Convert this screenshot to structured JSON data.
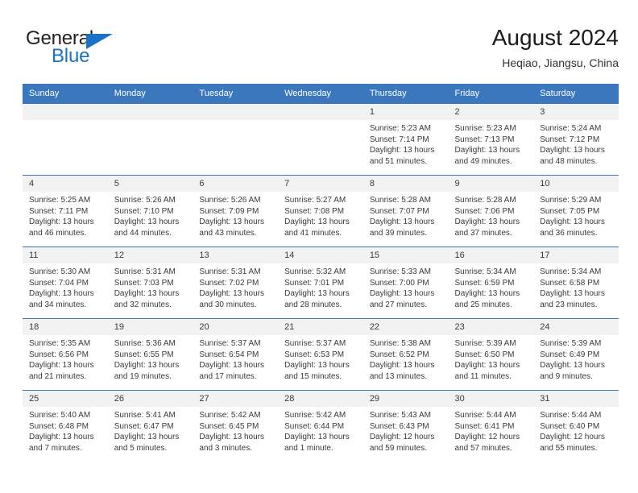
{
  "brand": {
    "name_part1": "General",
    "name_part2": "Blue",
    "triangle_icon": "triangle-icon",
    "color_primary": "#1a72c4",
    "color_text": "#231f20"
  },
  "header": {
    "title": "August 2024",
    "location": "Heqiao, Jiangsu, China"
  },
  "theme": {
    "header_bg": "#3b77bc",
    "header_text": "#ffffff",
    "daynum_bg": "#f2f2f2",
    "grid_line": "#3b77bc",
    "body_text": "#3a3a3a"
  },
  "weekdays": [
    "Sunday",
    "Monday",
    "Tuesday",
    "Wednesday",
    "Thursday",
    "Friday",
    "Saturday"
  ],
  "labels": {
    "sunrise_prefix": "Sunrise:",
    "sunset_prefix": "Sunset:",
    "daylight_prefix": "Daylight:"
  },
  "weeks": [
    [
      {
        "empty": true,
        "day": "",
        "sunrise": "",
        "sunset": "",
        "daylight_l1": "",
        "daylight_l2": ""
      },
      {
        "empty": true,
        "day": "",
        "sunrise": "",
        "sunset": "",
        "daylight_l1": "",
        "daylight_l2": ""
      },
      {
        "empty": true,
        "day": "",
        "sunrise": "",
        "sunset": "",
        "daylight_l1": "",
        "daylight_l2": ""
      },
      {
        "empty": true,
        "day": "",
        "sunrise": "",
        "sunset": "",
        "daylight_l1": "",
        "daylight_l2": ""
      },
      {
        "empty": false,
        "day": "1",
        "sunrise": "Sunrise: 5:23 AM",
        "sunset": "Sunset: 7:14 PM",
        "daylight_l1": "Daylight: 13 hours",
        "daylight_l2": "and 51 minutes."
      },
      {
        "empty": false,
        "day": "2",
        "sunrise": "Sunrise: 5:23 AM",
        "sunset": "Sunset: 7:13 PM",
        "daylight_l1": "Daylight: 13 hours",
        "daylight_l2": "and 49 minutes."
      },
      {
        "empty": false,
        "day": "3",
        "sunrise": "Sunrise: 5:24 AM",
        "sunset": "Sunset: 7:12 PM",
        "daylight_l1": "Daylight: 13 hours",
        "daylight_l2": "and 48 minutes."
      }
    ],
    [
      {
        "empty": false,
        "day": "4",
        "sunrise": "Sunrise: 5:25 AM",
        "sunset": "Sunset: 7:11 PM",
        "daylight_l1": "Daylight: 13 hours",
        "daylight_l2": "and 46 minutes."
      },
      {
        "empty": false,
        "day": "5",
        "sunrise": "Sunrise: 5:26 AM",
        "sunset": "Sunset: 7:10 PM",
        "daylight_l1": "Daylight: 13 hours",
        "daylight_l2": "and 44 minutes."
      },
      {
        "empty": false,
        "day": "6",
        "sunrise": "Sunrise: 5:26 AM",
        "sunset": "Sunset: 7:09 PM",
        "daylight_l1": "Daylight: 13 hours",
        "daylight_l2": "and 43 minutes."
      },
      {
        "empty": false,
        "day": "7",
        "sunrise": "Sunrise: 5:27 AM",
        "sunset": "Sunset: 7:08 PM",
        "daylight_l1": "Daylight: 13 hours",
        "daylight_l2": "and 41 minutes."
      },
      {
        "empty": false,
        "day": "8",
        "sunrise": "Sunrise: 5:28 AM",
        "sunset": "Sunset: 7:07 PM",
        "daylight_l1": "Daylight: 13 hours",
        "daylight_l2": "and 39 minutes."
      },
      {
        "empty": false,
        "day": "9",
        "sunrise": "Sunrise: 5:28 AM",
        "sunset": "Sunset: 7:06 PM",
        "daylight_l1": "Daylight: 13 hours",
        "daylight_l2": "and 37 minutes."
      },
      {
        "empty": false,
        "day": "10",
        "sunrise": "Sunrise: 5:29 AM",
        "sunset": "Sunset: 7:05 PM",
        "daylight_l1": "Daylight: 13 hours",
        "daylight_l2": "and 36 minutes."
      }
    ],
    [
      {
        "empty": false,
        "day": "11",
        "sunrise": "Sunrise: 5:30 AM",
        "sunset": "Sunset: 7:04 PM",
        "daylight_l1": "Daylight: 13 hours",
        "daylight_l2": "and 34 minutes."
      },
      {
        "empty": false,
        "day": "12",
        "sunrise": "Sunrise: 5:31 AM",
        "sunset": "Sunset: 7:03 PM",
        "daylight_l1": "Daylight: 13 hours",
        "daylight_l2": "and 32 minutes."
      },
      {
        "empty": false,
        "day": "13",
        "sunrise": "Sunrise: 5:31 AM",
        "sunset": "Sunset: 7:02 PM",
        "daylight_l1": "Daylight: 13 hours",
        "daylight_l2": "and 30 minutes."
      },
      {
        "empty": false,
        "day": "14",
        "sunrise": "Sunrise: 5:32 AM",
        "sunset": "Sunset: 7:01 PM",
        "daylight_l1": "Daylight: 13 hours",
        "daylight_l2": "and 28 minutes."
      },
      {
        "empty": false,
        "day": "15",
        "sunrise": "Sunrise: 5:33 AM",
        "sunset": "Sunset: 7:00 PM",
        "daylight_l1": "Daylight: 13 hours",
        "daylight_l2": "and 27 minutes."
      },
      {
        "empty": false,
        "day": "16",
        "sunrise": "Sunrise: 5:34 AM",
        "sunset": "Sunset: 6:59 PM",
        "daylight_l1": "Daylight: 13 hours",
        "daylight_l2": "and 25 minutes."
      },
      {
        "empty": false,
        "day": "17",
        "sunrise": "Sunrise: 5:34 AM",
        "sunset": "Sunset: 6:58 PM",
        "daylight_l1": "Daylight: 13 hours",
        "daylight_l2": "and 23 minutes."
      }
    ],
    [
      {
        "empty": false,
        "day": "18",
        "sunrise": "Sunrise: 5:35 AM",
        "sunset": "Sunset: 6:56 PM",
        "daylight_l1": "Daylight: 13 hours",
        "daylight_l2": "and 21 minutes."
      },
      {
        "empty": false,
        "day": "19",
        "sunrise": "Sunrise: 5:36 AM",
        "sunset": "Sunset: 6:55 PM",
        "daylight_l1": "Daylight: 13 hours",
        "daylight_l2": "and 19 minutes."
      },
      {
        "empty": false,
        "day": "20",
        "sunrise": "Sunrise: 5:37 AM",
        "sunset": "Sunset: 6:54 PM",
        "daylight_l1": "Daylight: 13 hours",
        "daylight_l2": "and 17 minutes."
      },
      {
        "empty": false,
        "day": "21",
        "sunrise": "Sunrise: 5:37 AM",
        "sunset": "Sunset: 6:53 PM",
        "daylight_l1": "Daylight: 13 hours",
        "daylight_l2": "and 15 minutes."
      },
      {
        "empty": false,
        "day": "22",
        "sunrise": "Sunrise: 5:38 AM",
        "sunset": "Sunset: 6:52 PM",
        "daylight_l1": "Daylight: 13 hours",
        "daylight_l2": "and 13 minutes."
      },
      {
        "empty": false,
        "day": "23",
        "sunrise": "Sunrise: 5:39 AM",
        "sunset": "Sunset: 6:50 PM",
        "daylight_l1": "Daylight: 13 hours",
        "daylight_l2": "and 11 minutes."
      },
      {
        "empty": false,
        "day": "24",
        "sunrise": "Sunrise: 5:39 AM",
        "sunset": "Sunset: 6:49 PM",
        "daylight_l1": "Daylight: 13 hours",
        "daylight_l2": "and 9 minutes."
      }
    ],
    [
      {
        "empty": false,
        "day": "25",
        "sunrise": "Sunrise: 5:40 AM",
        "sunset": "Sunset: 6:48 PM",
        "daylight_l1": "Daylight: 13 hours",
        "daylight_l2": "and 7 minutes."
      },
      {
        "empty": false,
        "day": "26",
        "sunrise": "Sunrise: 5:41 AM",
        "sunset": "Sunset: 6:47 PM",
        "daylight_l1": "Daylight: 13 hours",
        "daylight_l2": "and 5 minutes."
      },
      {
        "empty": false,
        "day": "27",
        "sunrise": "Sunrise: 5:42 AM",
        "sunset": "Sunset: 6:45 PM",
        "daylight_l1": "Daylight: 13 hours",
        "daylight_l2": "and 3 minutes."
      },
      {
        "empty": false,
        "day": "28",
        "sunrise": "Sunrise: 5:42 AM",
        "sunset": "Sunset: 6:44 PM",
        "daylight_l1": "Daylight: 13 hours",
        "daylight_l2": "and 1 minute."
      },
      {
        "empty": false,
        "day": "29",
        "sunrise": "Sunrise: 5:43 AM",
        "sunset": "Sunset: 6:43 PM",
        "daylight_l1": "Daylight: 12 hours",
        "daylight_l2": "and 59 minutes."
      },
      {
        "empty": false,
        "day": "30",
        "sunrise": "Sunrise: 5:44 AM",
        "sunset": "Sunset: 6:41 PM",
        "daylight_l1": "Daylight: 12 hours",
        "daylight_l2": "and 57 minutes."
      },
      {
        "empty": false,
        "day": "31",
        "sunrise": "Sunrise: 5:44 AM",
        "sunset": "Sunset: 6:40 PM",
        "daylight_l1": "Daylight: 12 hours",
        "daylight_l2": "and 55 minutes."
      }
    ]
  ]
}
